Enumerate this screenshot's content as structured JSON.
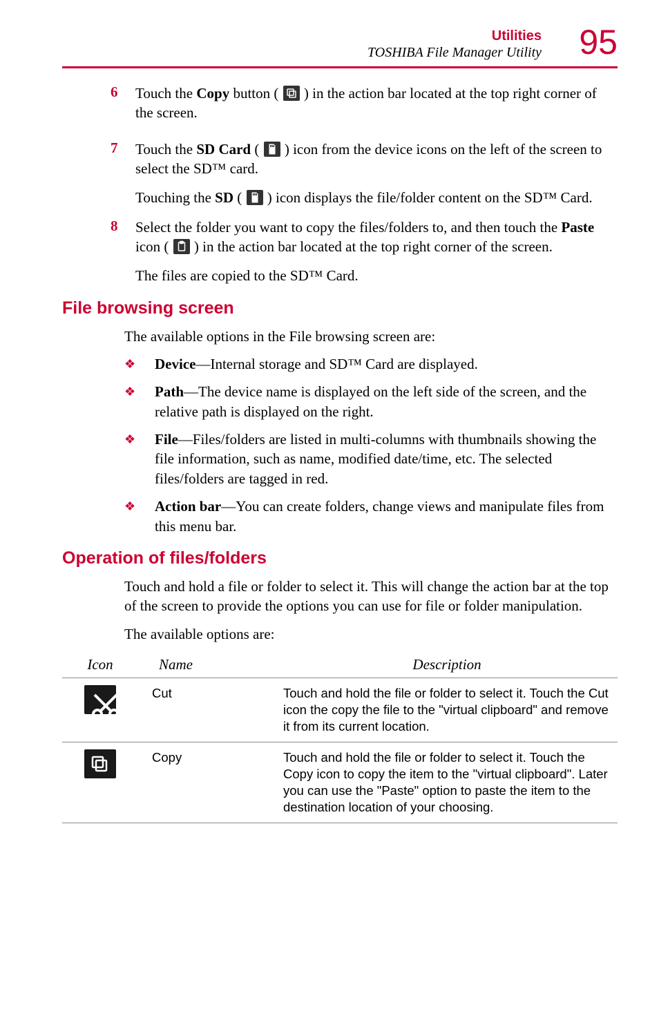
{
  "header": {
    "title": "Utilities",
    "subtitle": "TOSHIBA File Manager Utility",
    "page_number": "95"
  },
  "steps": [
    {
      "num": "6",
      "html": "Touch the <b>Copy</b> button ( {icon:copy} ) in the action bar located at the top right corner of the screen."
    },
    {
      "num": "7",
      "html": "Touch the <b>SD Card</b> ( {icon:sd} ) icon from the device icons on the left of the screen to select the SD™ card.",
      "after": "Touching the <b>SD</b> ( {icon:sd} ) icon displays the file/folder content on the SD™ Card."
    },
    {
      "num": "8",
      "html": "Select the folder you want to copy the files/folders to, and then touch the <b>Paste</b> icon ( {icon:paste} ) in the action bar located at the top right corner of the screen.",
      "after": "The files are copied to the SD™ Card."
    }
  ],
  "section1": {
    "title": "File browsing screen",
    "intro": "The available options in the File browsing screen are:",
    "bullets": [
      "<b>Device</b>—Internal storage and SD™ Card are displayed.",
      "<b>Path</b>—The device name is displayed on the left side of the screen, and the relative path is displayed on the right.",
      "<b>File</b>—Files/folders are listed in multi-columns with thumbnails showing the file information, such as name, modified date/time, etc. The selected files/folders are tagged in red.",
      "<b>Action bar</b>—You can create folders, change views and manipulate files from this menu bar."
    ]
  },
  "section2": {
    "title": "Operation of files/folders",
    "para": "Touch and hold a file or folder to select it. This will change the action bar at the top of the screen to provide the options you can use for file or folder manipulation.",
    "intro": "The available options are:",
    "table": {
      "headers": {
        "icon": "Icon",
        "name": "Name",
        "desc": "Description"
      },
      "rows": [
        {
          "icon": "cut",
          "name": "Cut",
          "desc": "Touch and hold the file or folder to select it. Touch the Cut icon the copy the file to the \"virtual clipboard\" and remove it from its current location."
        },
        {
          "icon": "copy",
          "name": "Copy",
          "desc": "Touch and hold the file or folder to select it. Touch the Copy icon to copy the item to the \"virtual clipboard\". Later you can use the \"Paste\" option to paste the item to the destination location of your choosing."
        }
      ]
    }
  }
}
